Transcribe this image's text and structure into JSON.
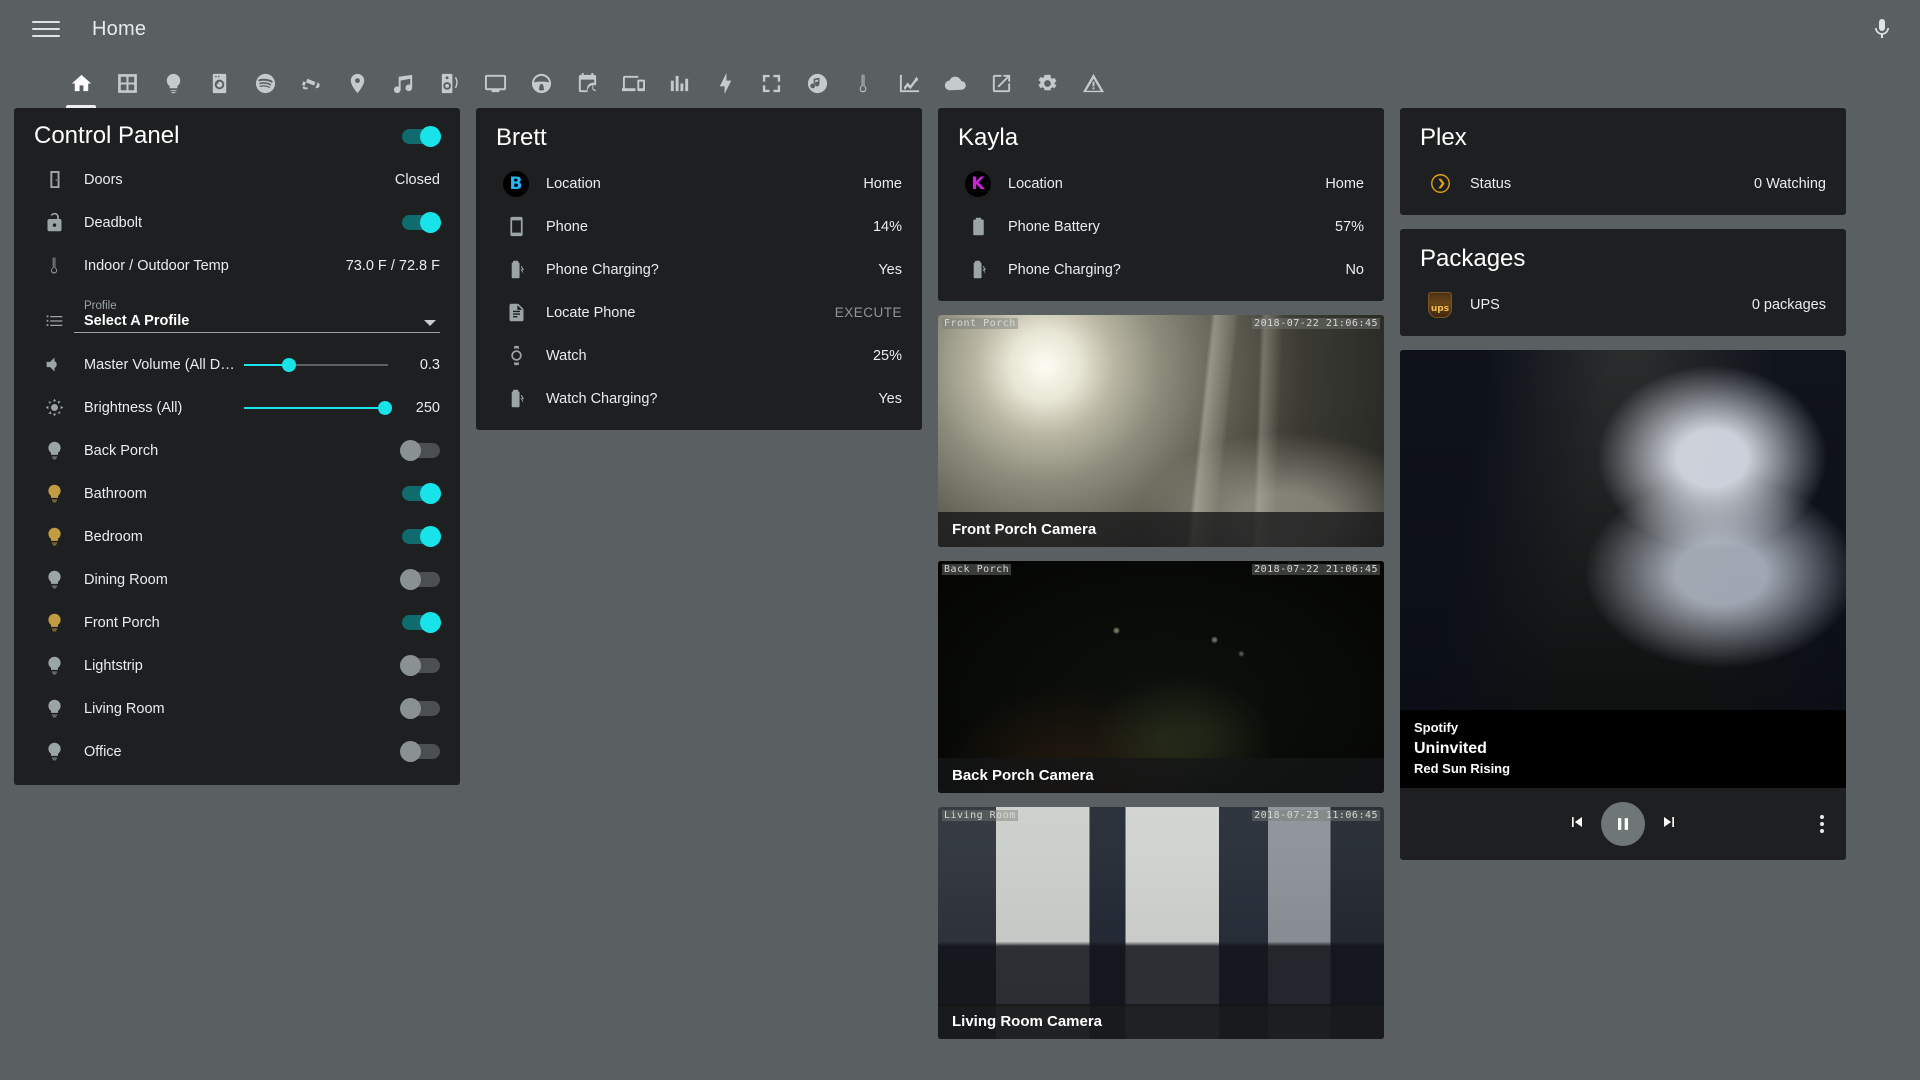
{
  "app": {
    "title": "Home",
    "menu_icon": "hamburger-menu-icon",
    "assist_icon": "microphone-icon"
  },
  "tabs": [
    {
      "name": "home",
      "icon": "home-icon",
      "active": true
    },
    {
      "name": "overview",
      "icon": "view-grid-icon",
      "active": false
    },
    {
      "name": "lights",
      "icon": "lightbulb-icon",
      "active": false
    },
    {
      "name": "laundry",
      "icon": "washing-machine-icon",
      "active": false
    },
    {
      "name": "spotify",
      "icon": "spotify-icon",
      "active": false
    },
    {
      "name": "cameras",
      "icon": "cctv-icon",
      "active": false
    },
    {
      "name": "location",
      "icon": "map-marker-icon",
      "active": false
    },
    {
      "name": "music",
      "icon": "music-note-icon",
      "active": false
    },
    {
      "name": "speakers",
      "icon": "speaker-wireless-icon",
      "active": false
    },
    {
      "name": "tv",
      "icon": "monitor-icon",
      "active": false
    },
    {
      "name": "car",
      "icon": "steering-wheel-icon",
      "active": false
    },
    {
      "name": "calendar",
      "icon": "calendar-clock-icon",
      "active": false
    },
    {
      "name": "devices",
      "icon": "devices-icon",
      "active": false
    },
    {
      "name": "statistics",
      "icon": "chart-bar-icon",
      "active": false
    },
    {
      "name": "energy",
      "icon": "lightning-bolt-icon",
      "active": false
    },
    {
      "name": "automations",
      "icon": "fullscreen-icon",
      "active": false
    },
    {
      "name": "media",
      "icon": "music-circle-icon",
      "active": false
    },
    {
      "name": "climate",
      "icon": "thermometer-icon",
      "active": false
    },
    {
      "name": "history",
      "icon": "chart-line-icon",
      "active": false
    },
    {
      "name": "weather",
      "icon": "cloud-icon",
      "active": false
    },
    {
      "name": "external",
      "icon": "open-in-new-icon",
      "active": false
    },
    {
      "name": "settings",
      "icon": "gear-icon",
      "active": false
    },
    {
      "name": "alerts",
      "icon": "alert-triangle-icon",
      "active": false
    }
  ],
  "control_panel": {
    "title": "Control Panel",
    "header_toggle": "on",
    "rows": [
      {
        "icon": "door-icon",
        "label": "Doors",
        "value": "Closed",
        "type": "text"
      },
      {
        "icon": "lock-open-icon",
        "label": "Deadbolt",
        "value": "on",
        "type": "toggle"
      },
      {
        "icon": "thermometer-icon",
        "label": "Indoor / Outdoor Temp",
        "value": "73.0 F / 72.8 F",
        "type": "text"
      }
    ],
    "profile": {
      "icon": "format-list-icon",
      "label": "Profile",
      "value": "Select A Profile"
    },
    "sliders": [
      {
        "icon": "volume-icon",
        "label": "Master Volume (All Devic…",
        "value": "0.3",
        "percent": 31
      },
      {
        "icon": "brightness-icon",
        "label": "Brightness (All)",
        "value": "250",
        "percent": 98
      }
    ],
    "lights": [
      {
        "icon": "lightbulb-icon",
        "label": "Back Porch",
        "state": "off"
      },
      {
        "icon": "lightbulb-icon",
        "label": "Bathroom",
        "state": "on"
      },
      {
        "icon": "lightbulb-icon",
        "label": "Bedroom",
        "state": "on"
      },
      {
        "icon": "lightbulb-icon",
        "label": "Dining Room",
        "state": "off"
      },
      {
        "icon": "lightbulb-icon",
        "label": "Front Porch",
        "state": "on"
      },
      {
        "icon": "lightbulb-icon",
        "label": "Lightstrip",
        "state": "off"
      },
      {
        "icon": "lightbulb-icon",
        "label": "Living Room",
        "state": "off"
      },
      {
        "icon": "lightbulb-icon",
        "label": "Office",
        "state": "off"
      }
    ]
  },
  "brett": {
    "title": "Brett",
    "avatar_letter": "B",
    "avatar_color": "#29b6f6",
    "rows": [
      {
        "icon": "avatar",
        "label": "Location",
        "value": "Home"
      },
      {
        "icon": "cellphone-icon",
        "label": "Phone",
        "value": "14%"
      },
      {
        "icon": "battery-charging-icon",
        "label": "Phone Charging?",
        "value": "Yes"
      },
      {
        "icon": "script-icon",
        "label": "Locate Phone",
        "value": "EXECUTE",
        "dim": true
      },
      {
        "icon": "watch-icon",
        "label": "Watch",
        "value": "25%"
      },
      {
        "icon": "battery-charging-icon",
        "label": "Watch Charging?",
        "value": "Yes"
      }
    ]
  },
  "kayla": {
    "title": "Kayla",
    "avatar_letter": "K",
    "avatar_color": "#cc22dd",
    "rows": [
      {
        "icon": "avatar",
        "label": "Location",
        "value": "Home"
      },
      {
        "icon": "battery-icon",
        "label": "Phone Battery",
        "value": "57%"
      },
      {
        "icon": "battery-charging-icon",
        "label": "Phone Charging?",
        "value": "No"
      }
    ]
  },
  "plex": {
    "title": "Plex",
    "rows": [
      {
        "icon": "plex-icon",
        "label": "Status",
        "value": "0 Watching"
      }
    ]
  },
  "packages": {
    "title": "Packages",
    "rows": [
      {
        "icon": "ups-icon",
        "label": "UPS",
        "value": "0 packages"
      }
    ]
  },
  "cameras": [
    {
      "name": "Front Porch Camera",
      "osd_label": "Front Porch",
      "osd_time": "2018-07-22 21:06:45",
      "scene": "front-porch"
    },
    {
      "name": "Back Porch Camera",
      "osd_label": "Back Porch",
      "osd_time": "2018-07-22 21:06:45",
      "scene": "back-porch"
    },
    {
      "name": "Living Room Camera",
      "osd_label": "Living Room",
      "osd_time": "2018-07-23 11:06:45",
      "scene": "living-room"
    }
  ],
  "media_player": {
    "app": "Spotify",
    "track": "Uninvited",
    "artist": "Red Sun Rising",
    "state": "playing",
    "controls": {
      "previous": "skip-previous-icon",
      "play_pause": "pause-icon",
      "next": "skip-next-icon",
      "more": "dots-vertical-icon"
    }
  },
  "colors": {
    "accent": "#17e3e8",
    "card_bg": "#1d1f20",
    "page_bg": "#5a6061",
    "light_on": "#c39c42"
  }
}
